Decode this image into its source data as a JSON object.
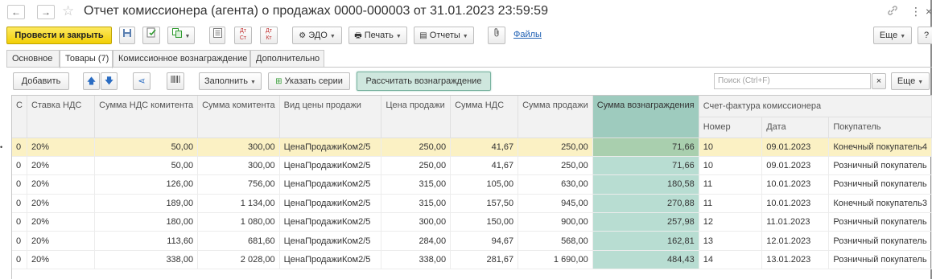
{
  "window": {
    "title": "Отчет комиссионера (агента) о продажах 0000-000003 от 31.01.2023 23:59:59",
    "back_glyph": "←",
    "forward_glyph": "→",
    "star_glyph": "☆",
    "link_glyph": "🔗",
    "more_glyph": "⋮",
    "close_glyph": "×"
  },
  "toolbar": {
    "post_close_label": "Провести и закрыть",
    "edo_label": "ЭДО",
    "print_label": "Печать",
    "reports_label": "Отчеты",
    "files_label": "Файлы",
    "more_label": "Еще",
    "help_label": "?",
    "dt_kt_label": "Дт Кт",
    "icons": [
      "save-icon",
      "post-icon",
      "create-based-on-icon",
      "list-icon",
      "dt-ct-icon",
      "dt-kt-icon",
      "edo-icon",
      "printer-icon",
      "reports-icon",
      "paperclip-icon"
    ]
  },
  "tabs": [
    {
      "label": "Основное"
    },
    {
      "label": "Товары (7)"
    },
    {
      "label": "Комиссионное вознаграждение"
    },
    {
      "label": "Дополнительно"
    }
  ],
  "tab_active_index": 1,
  "table_toolbar": {
    "add_label": "Добавить",
    "fill_label": "Заполнить",
    "series_label": "Указать серии",
    "calc_label": "Рассчитать вознаграждение",
    "search_placeholder": "Поиск (Ctrl+F)",
    "clear_glyph": "×",
    "more_label": "Еще"
  },
  "columns": {
    "c0": "С",
    "vat_rate": "Ставка НДС",
    "vat_principal": "Сумма НДС комитента",
    "sum_principal": "Сумма комитента",
    "price_type": "Вид цены продажи",
    "sale_price": "Цена продажи",
    "vat_sum": "Сумма НДС",
    "sale_sum": "Сумма продажи",
    "reward": "Сумма вознаграждения",
    "invoice_group": "Счет-фактура комиссионера",
    "inv_number": "Номер",
    "inv_date": "Дата",
    "buyer": "Покупатель"
  },
  "rows": [
    {
      "c0": "0",
      "vat_rate": "20%",
      "vat_principal": "50,00",
      "sum_principal": "300,00",
      "price_type": "ЦенаПродажиКом2/5",
      "sale_price": "250,00",
      "vat_sum": "41,67",
      "sale_sum": "250,00",
      "reward": "71,66",
      "inv_number": "10",
      "inv_date": "09.01.2023",
      "buyer": "Конечный покупатель4"
    },
    {
      "c0": "0",
      "vat_rate": "20%",
      "vat_principal": "50,00",
      "sum_principal": "300,00",
      "price_type": "ЦенаПродажиКом2/5",
      "sale_price": "250,00",
      "vat_sum": "41,67",
      "sale_sum": "250,00",
      "reward": "71,66",
      "inv_number": "10",
      "inv_date": "09.01.2023",
      "buyer": "Розничный покупатель"
    },
    {
      "c0": "0",
      "vat_rate": "20%",
      "vat_principal": "126,00",
      "sum_principal": "756,00",
      "price_type": "ЦенаПродажиКом2/5",
      "sale_price": "315,00",
      "vat_sum": "105,00",
      "sale_sum": "630,00",
      "reward": "180,58",
      "inv_number": "11",
      "inv_date": "10.01.2023",
      "buyer": "Розничный покупатель"
    },
    {
      "c0": "0",
      "vat_rate": "20%",
      "vat_principal": "189,00",
      "sum_principal": "1 134,00",
      "price_type": "ЦенаПродажиКом2/5",
      "sale_price": "315,00",
      "vat_sum": "157,50",
      "sale_sum": "945,00",
      "reward": "270,88",
      "inv_number": "11",
      "inv_date": "10.01.2023",
      "buyer": "Конечный покупатель3"
    },
    {
      "c0": "0",
      "vat_rate": "20%",
      "vat_principal": "180,00",
      "sum_principal": "1 080,00",
      "price_type": "ЦенаПродажиКом2/5",
      "sale_price": "300,00",
      "vat_sum": "150,00",
      "sale_sum": "900,00",
      "reward": "257,98",
      "inv_number": "12",
      "inv_date": "11.01.2023",
      "buyer": "Розничный покупатель"
    },
    {
      "c0": "0",
      "vat_rate": "20%",
      "vat_principal": "113,60",
      "sum_principal": "681,60",
      "price_type": "ЦенаПродажиКом2/5",
      "sale_price": "284,00",
      "vat_sum": "94,67",
      "sale_sum": "568,00",
      "reward": "162,81",
      "inv_number": "13",
      "inv_date": "12.01.2023",
      "buyer": "Розничный покупатель"
    },
    {
      "c0": "0",
      "vat_rate": "20%",
      "vat_principal": "338,00",
      "sum_principal": "2 028,00",
      "price_type": "ЦенаПродажиКом2/5",
      "sale_price": "338,00",
      "vat_sum": "281,67",
      "sale_sum": "1 690,00",
      "reward": "484,43",
      "inv_number": "14",
      "inv_date": "13.01.2023",
      "buyer": "Розничный покупатель"
    }
  ],
  "colors": {
    "primary_button": "#f2cf06",
    "reward_column": "#b8ddd2",
    "reward_header": "#9ecbbe",
    "selected_row": "#fbf1c4",
    "link": "#2061b4"
  }
}
